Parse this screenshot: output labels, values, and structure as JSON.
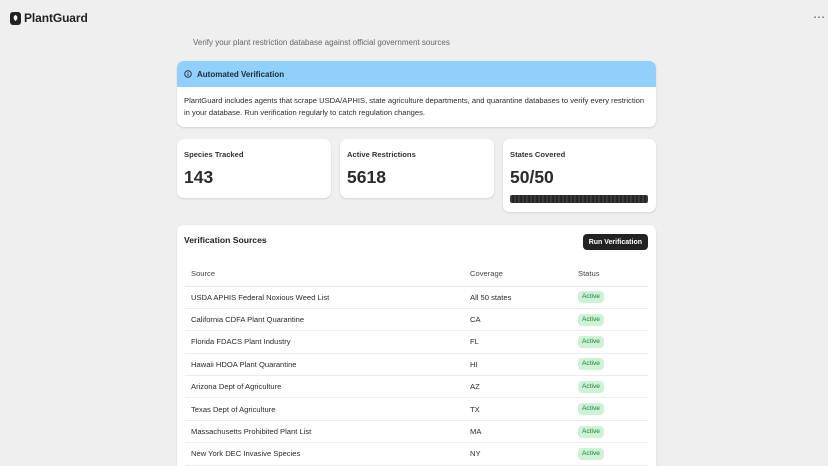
{
  "app": {
    "brand": "PlantGuard",
    "more_label": "⋯"
  },
  "page": {
    "subtitle": "Verify your plant restriction database against official government sources"
  },
  "alert": {
    "title": "Automated Verification",
    "body": "PlantGuard includes agents that scrape USDA/APHIS, state agriculture departments, and quarantine databases to verify every restriction in your database. Run verification regularly to catch regulation changes."
  },
  "stats": [
    {
      "label": "Species Tracked",
      "value": "143"
    },
    {
      "label": "Active Restrictions",
      "value": "5618"
    },
    {
      "label": "States Covered",
      "value": "50/50",
      "progress": 1.0
    }
  ],
  "sources": {
    "title": "Verification Sources",
    "run_button": "Run Verification",
    "columns": [
      "Source",
      "Coverage",
      "Status"
    ],
    "rows": [
      {
        "source": "USDA APHIS Federal Noxious Weed List",
        "coverage": "All 50 states",
        "status": "Active"
      },
      {
        "source": "California CDFA Plant Quarantine",
        "coverage": "CA",
        "status": "Active"
      },
      {
        "source": "Florida FDACS Plant Industry",
        "coverage": "FL",
        "status": "Active"
      },
      {
        "source": "Hawaii HDOA Plant Quarantine",
        "coverage": "HI",
        "status": "Active"
      },
      {
        "source": "Arizona Dept of Agriculture",
        "coverage": "AZ",
        "status": "Active"
      },
      {
        "source": "Texas Dept of Agriculture",
        "coverage": "TX",
        "status": "Active"
      },
      {
        "source": "Massachusetts Prohibited Plant List",
        "coverage": "MA",
        "status": "Active"
      },
      {
        "source": "New York DEC Invasive Species",
        "coverage": "NY",
        "status": "Active"
      }
    ]
  },
  "colors": {
    "alert_bg": "#90d0fb",
    "badge_bg": "#cdf3d6",
    "badge_text": "#1f7a38",
    "button_bg": "#222222"
  }
}
